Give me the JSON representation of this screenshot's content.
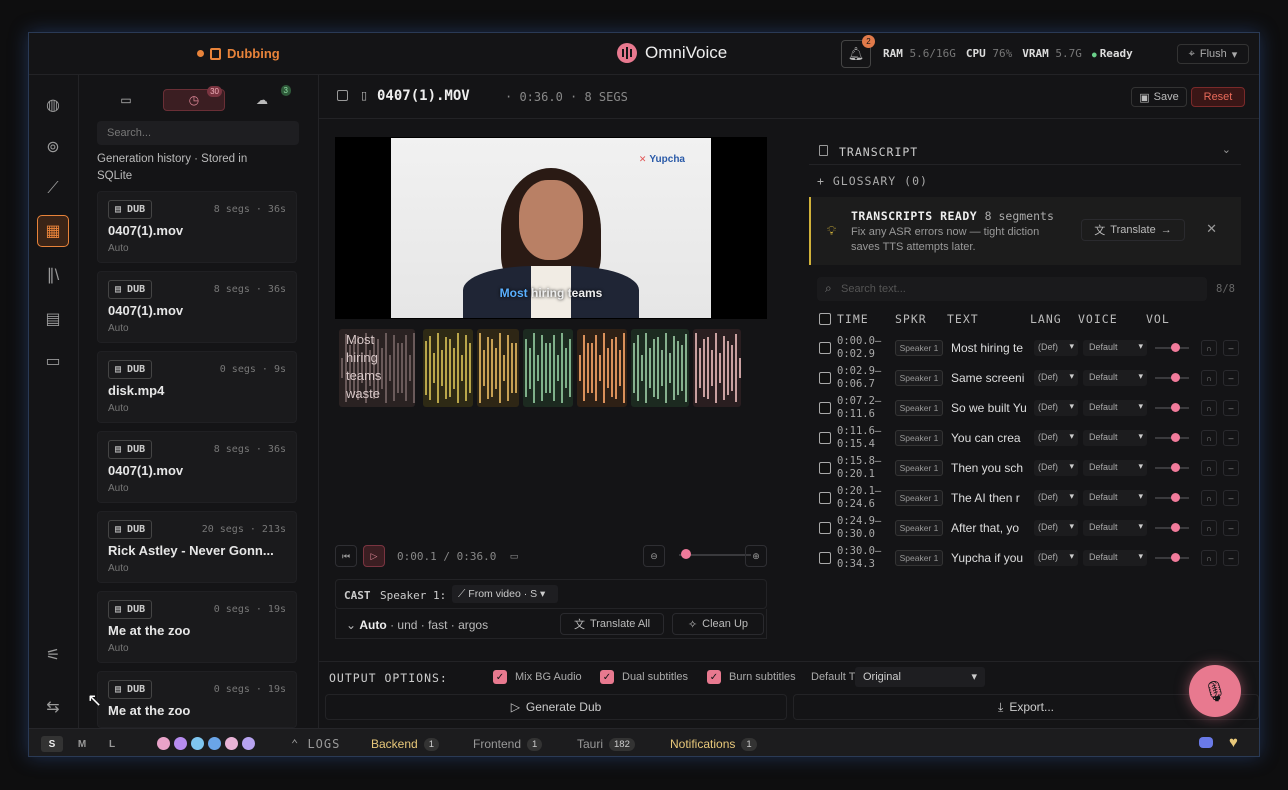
{
  "topbar": {
    "mode_label": "Dubbing",
    "app_title": "OmniVoice",
    "notification_count": "2",
    "ram_label": "RAM",
    "ram_value": "5.6/16G",
    "cpu_label": "CPU",
    "cpu_value": "76%",
    "vram_label": "VRAM",
    "vram_value": "5.7G",
    "status": "Ready",
    "flush_label": "Flush"
  },
  "history": {
    "tabs": [
      {
        "icon": "folder-icon",
        "count": ""
      },
      {
        "icon": "history-icon",
        "count": "30"
      },
      {
        "icon": "cloud-icon",
        "count": "3"
      }
    ],
    "search_placeholder": "Search...",
    "note": "Generation history · Stored in SQLite",
    "items": [
      {
        "tag": "DUB",
        "meta": "8 segs · 36s",
        "name": "0407(1).mov",
        "sub": "Auto"
      },
      {
        "tag": "DUB",
        "meta": "8 segs · 36s",
        "name": "0407(1).mov",
        "sub": "Auto"
      },
      {
        "tag": "DUB",
        "meta": "0 segs · 9s",
        "name": "disk.mp4",
        "sub": "Auto"
      },
      {
        "tag": "DUB",
        "meta": "8 segs · 36s",
        "name": "0407(1).mov",
        "sub": "Auto"
      },
      {
        "tag": "DUB",
        "meta": "20 segs · 213s",
        "name": "Rick Astley - Never Gonn...",
        "sub": "Auto"
      },
      {
        "tag": "DUB",
        "meta": "0 segs · 19s",
        "name": "Me at the zoo",
        "sub": "Auto"
      },
      {
        "tag": "DUB",
        "meta": "0 segs · 19s",
        "name": "Me at the zoo",
        "sub": ""
      }
    ]
  },
  "file": {
    "name": "0407(1).MOV",
    "meta": "· 0:36.0 · 8 SEGS",
    "save_label": "Save",
    "reset_label": "Reset"
  },
  "video": {
    "brand": "Yupcha",
    "caption_highlight": "Most",
    "caption_rest": " hiring teams",
    "waveform_text": "Most hiring teams waste"
  },
  "transport": {
    "time": "0:00.1 / 0:36.0"
  },
  "cast": {
    "label": "CAST",
    "speaker": "Speaker 1:",
    "source": "From video · S"
  },
  "options": {
    "auto": "Auto",
    "rest": "· und · fast · argos",
    "translate_all": "Translate All",
    "clean_up": "Clean Up"
  },
  "transcript": {
    "title": "TRANSCRIPT",
    "glossary": "+ GLOSSARY (0)",
    "banner_title": "TRANSCRIPTS READY",
    "banner_count": "8 segments",
    "banner_body": "Fix any ASR errors now — tight diction saves TTS attempts later.",
    "translate_label": "Translate",
    "search_placeholder": "Search text...",
    "count": "8/8",
    "columns": [
      "TIME",
      "SPKR",
      "TEXT",
      "LANG",
      "VOICE",
      "VOL"
    ],
    "rows": [
      {
        "t1": "0:00.0–",
        "t2": "0:02.9",
        "spk": "Speaker 1",
        "text": "Most hiring te",
        "lang": "(Def)",
        "voice": "Default"
      },
      {
        "t1": "0:02.9–",
        "t2": "0:06.7",
        "spk": "Speaker 1",
        "text": "Same screeni",
        "lang": "(Def)",
        "voice": "Default"
      },
      {
        "t1": "0:07.2–",
        "t2": "0:11.6",
        "spk": "Speaker 1",
        "text": "So we built Yu",
        "lang": "(Def)",
        "voice": "Default"
      },
      {
        "t1": "0:11.6–",
        "t2": "0:15.4",
        "spk": "Speaker 1",
        "text": "You can crea",
        "lang": "(Def)",
        "voice": "Default"
      },
      {
        "t1": "0:15.8–",
        "t2": "0:20.1",
        "spk": "Speaker 1",
        "text": "Then you sch",
        "lang": "(Def)",
        "voice": "Default"
      },
      {
        "t1": "0:20.1–",
        "t2": "0:24.6",
        "spk": "Speaker 1",
        "text": "The AI then r",
        "lang": "(Def)",
        "voice": "Default"
      },
      {
        "t1": "0:24.9–",
        "t2": "0:30.0",
        "spk": "Speaker 1",
        "text": "After that, yo",
        "lang": "(Def)",
        "voice": "Default"
      },
      {
        "t1": "0:30.0–",
        "t2": "0:34.3",
        "spk": "Speaker 1",
        "text": "Yupcha if you",
        "lang": "(Def)",
        "voice": "Default"
      }
    ]
  },
  "output": {
    "label": "OUTPUT OPTIONS:",
    "mix_bg": "Mix BG Audio",
    "dual_subs": "Dual subtitles",
    "burn_subs": "Burn subtitles",
    "default_track_label": "Default Track:",
    "default_track_value": "Original",
    "generate_label": "Generate Dub",
    "export_label": "Export..."
  },
  "status": {
    "sizes": [
      "S",
      "M",
      "L"
    ],
    "swatches": [
      "#e9a3c9",
      "#b78cf0",
      "#7fc6f0",
      "#6aa5e8",
      "#e9b3d6",
      "#b7a3f0"
    ],
    "logs_label": "LOGS",
    "tabs": [
      {
        "label": "Backend",
        "count": "1",
        "color": "#e8c87a"
      },
      {
        "label": "Frontend",
        "count": "1",
        "color": "#999999"
      },
      {
        "label": "Tauri",
        "count": "182",
        "color": "#999999"
      },
      {
        "label": "Notifications",
        "count": "1",
        "color": "#e8c87a"
      }
    ]
  }
}
